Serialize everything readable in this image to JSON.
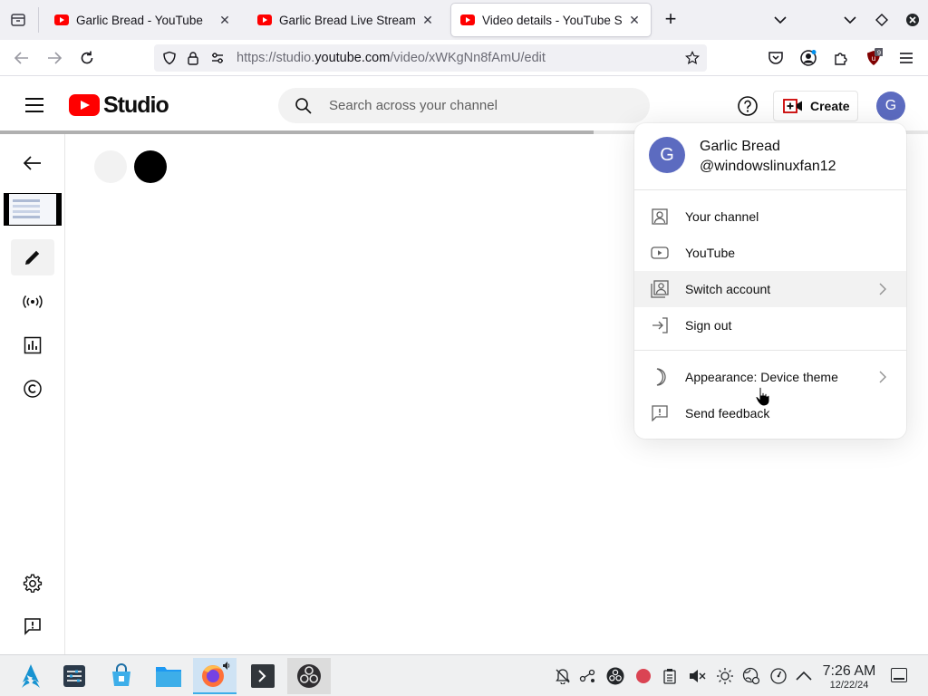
{
  "browser": {
    "tabs": [
      {
        "title": "Garlic Bread - YouTube",
        "active": false
      },
      {
        "title": "Garlic Bread Live Stream - ",
        "active": false
      },
      {
        "title": "Video details - YouTube Stu",
        "active": true
      }
    ],
    "new_tab_label": "+",
    "url_prefix": "https://studio.",
    "url_host": "youtube.com",
    "url_path": "/video/xWKgNn8fAmU/edit",
    "extension_badge": "9"
  },
  "studio": {
    "logo_text": "Studio",
    "search_placeholder": "Search across your channel",
    "create_label": "Create",
    "avatar_initial": "G",
    "loading_progress_pct": 64
  },
  "account_menu": {
    "avatar_initial": "G",
    "name": "Garlic Bread",
    "handle": "@windowslinuxfan12",
    "items": [
      {
        "label": "Your channel",
        "icon": "account-box-icon",
        "has_submenu": false
      },
      {
        "label": "YouTube",
        "icon": "youtube-icon",
        "has_submenu": false
      },
      {
        "label": "Switch account",
        "icon": "switch-account-icon",
        "has_submenu": true
      },
      {
        "label": "Sign out",
        "icon": "sign-out-icon",
        "has_submenu": false
      },
      {
        "label": "Appearance: Device theme",
        "icon": "moon-icon",
        "has_submenu": true
      },
      {
        "label": "Send feedback",
        "icon": "feedback-icon",
        "has_submenu": false
      }
    ]
  },
  "taskbar": {
    "time": "7:26 AM",
    "date": "12/22/24"
  },
  "colors": {
    "youtube_red": "#ff0000",
    "avatar_bg": "#5c6bc0",
    "hover_bg": "#f2f2f2",
    "taskbar_bg": "#eff0f1",
    "taskbar_accent": "#3daee9"
  }
}
